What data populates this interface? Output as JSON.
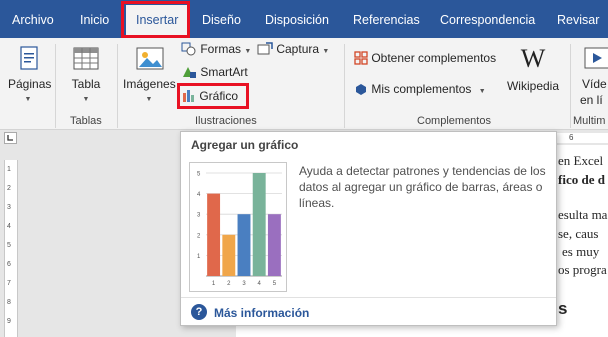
{
  "tabs": [
    "Archivo",
    "Inicio",
    "Insertar",
    "Diseño",
    "Disposición",
    "Referencias",
    "Correspondencia",
    "Revisar"
  ],
  "active_tab": "Insertar",
  "ribbon": {
    "paginas": "Páginas",
    "tabla": "Tabla",
    "imagenes": "Imágenes",
    "formas": "Formas",
    "smartart": "SmartArt",
    "grafico": "Gráfico",
    "captura": "Captura",
    "obtener": "Obtener complementos",
    "mis": "Mis complementos",
    "wikipedia": "Wikipedia",
    "video_1": "Víde",
    "video_2": "en lí",
    "groups": {
      "tablas": "Tablas",
      "ilustraciones": "Ilustraciones",
      "complementos": "Complementos",
      "multimedia": "Multim"
    }
  },
  "ruler": {
    "top_mark": "6",
    "v_ticks": [
      "1",
      "2",
      "3",
      "4",
      "5",
      "6",
      "7",
      "8",
      "9"
    ]
  },
  "document": {
    "line1": "en Excel",
    "line2": "fico de d",
    "line3": "esulta ma",
    "line4": "se,  caus",
    "line5": "es  muy",
    "line6": "os progra",
    "heading_frag": "s"
  },
  "tooltip": {
    "title": "Agregar un gráfico",
    "description": "Ayuda a detectar patrones y tendencias de los datos al agregar un gráfico de barras, áreas o líneas.",
    "more_info": "Más información",
    "help_glyph": "?"
  },
  "chart_data": {
    "type": "bar",
    "categories": [
      "1",
      "2",
      "3",
      "4",
      "5"
    ],
    "values": [
      4,
      2,
      3,
      5,
      3
    ],
    "colors": [
      "#e0684b",
      "#f0a64a",
      "#4a7fc1",
      "#79b39a",
      "#9a6fbf"
    ],
    "ylim": [
      0,
      5
    ],
    "yticks": [
      "1",
      "2",
      "3",
      "4",
      "5"
    ],
    "grid": true
  },
  "colors": {
    "ribbon_blue": "#2b579a",
    "highlight_red": "#e81123"
  }
}
